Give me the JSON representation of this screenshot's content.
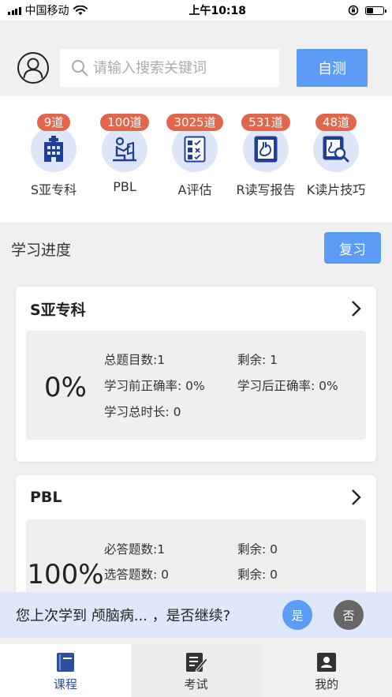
{
  "status_bar": {
    "carrier": "中国移动",
    "time": "上午10:18",
    "battery_level": 0.4
  },
  "header": {
    "search_placeholder": "请输入搜索关键词",
    "selftest_label": "自测"
  },
  "categories": [
    {
      "badge": "9道",
      "label": "S亚专科",
      "icon": "hospital-icon"
    },
    {
      "badge": "100道",
      "label": "PBL",
      "icon": "reading-person-icon"
    },
    {
      "badge": "3025道",
      "label": "A评估",
      "icon": "checklist-icon"
    },
    {
      "badge": "531道",
      "label": "R读写报告",
      "icon": "stomach-report-icon"
    },
    {
      "badge": "48道",
      "label": "K读片技巧",
      "icon": "scan-magnify-icon"
    }
  ],
  "progress": {
    "title": "学习进度",
    "review_label": "复习"
  },
  "courses": [
    {
      "title": "S亚专科",
      "percent": "0%",
      "row1_left": "总题目数:1",
      "row1_right": "剩余:  1",
      "row2_left": "学习前正确率:  0%",
      "row2_right": "学习后正确率:  0%",
      "row3_left": "学习总时长:  0"
    },
    {
      "title": "PBL",
      "percent": "100%",
      "row1_left": "必答题数:1",
      "row1_right": "剩余:  0",
      "row2_left": "选答题数:  0",
      "row2_right": "剩余:  0"
    }
  ],
  "continue_prompt": {
    "text": "您上次学到 颅脑病...  ，是否继续?",
    "yes_label": "是",
    "no_label": "否"
  },
  "tabs": [
    {
      "label": "课程",
      "icon": "book-icon",
      "active": true
    },
    {
      "label": "考试",
      "icon": "exam-paper-icon",
      "active": false
    },
    {
      "label": "我的",
      "icon": "profile-card-icon",
      "active": false
    }
  ],
  "colors": {
    "accent": "#5b9cf6",
    "badge": "#e0664c",
    "icon_bg": "#dde6f8",
    "tab_active": "#2c4fa0"
  }
}
